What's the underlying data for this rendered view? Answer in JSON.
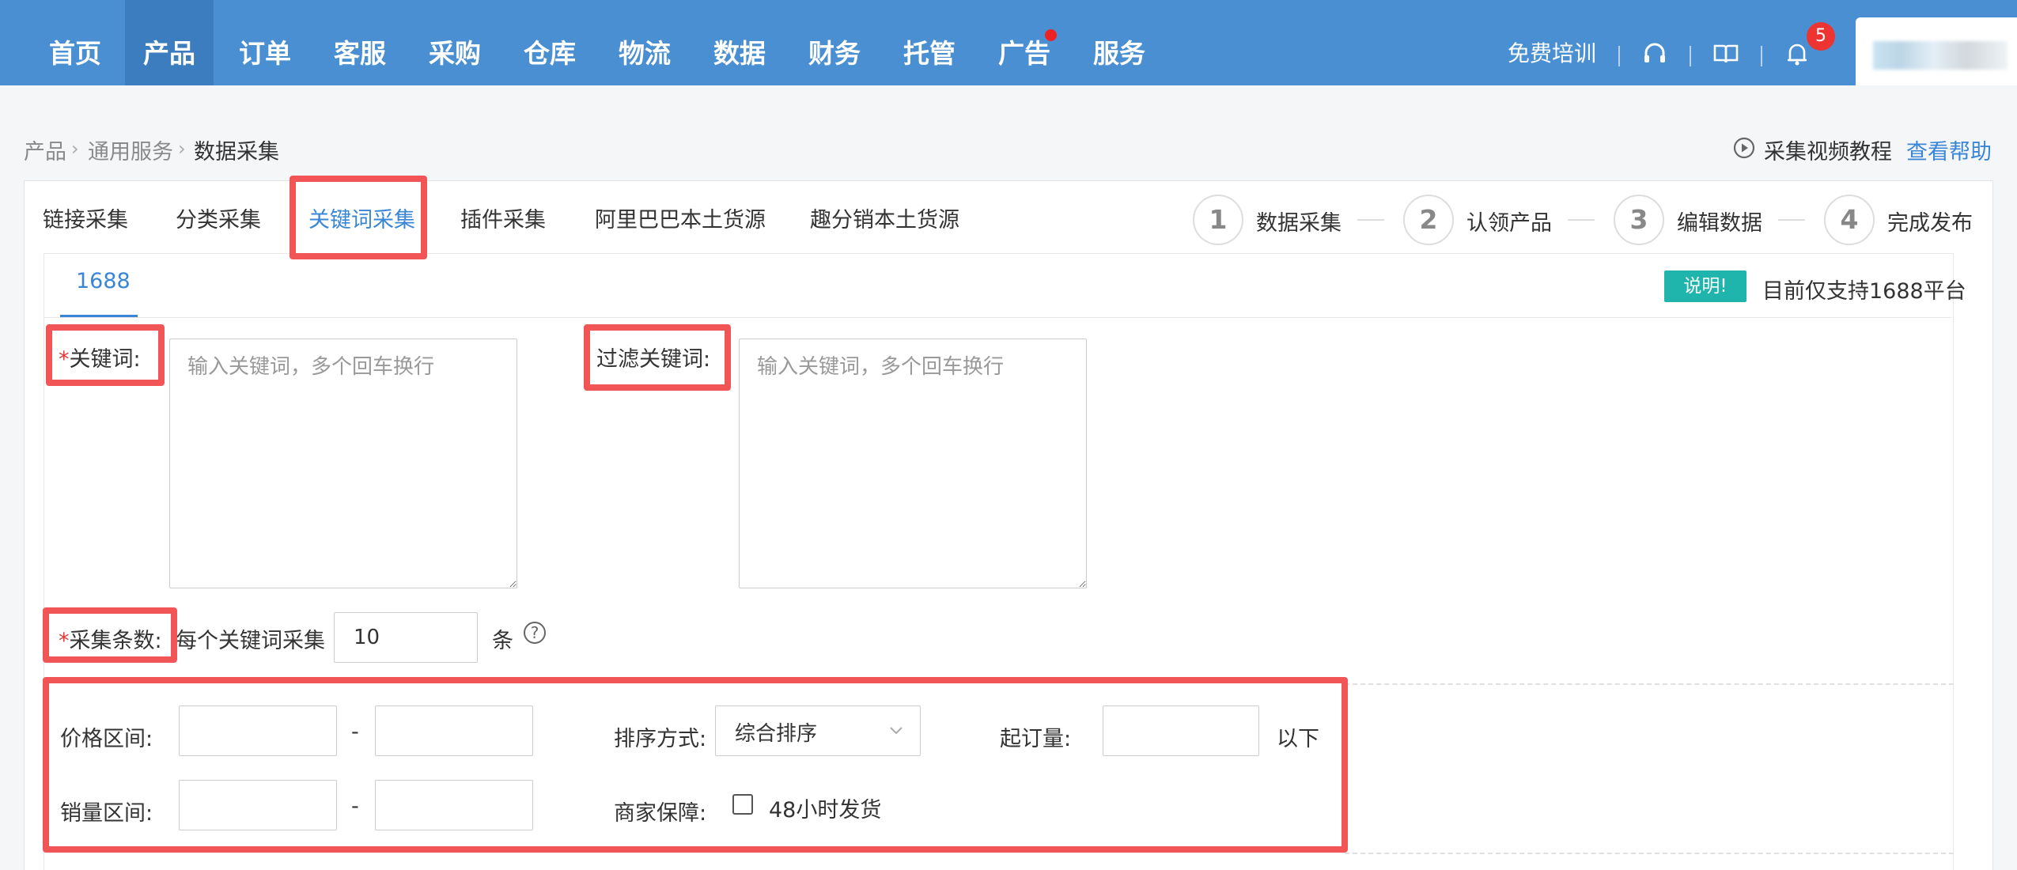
{
  "nav": {
    "items": [
      "首页",
      "产品",
      "订单",
      "客服",
      "采购",
      "仓库",
      "物流",
      "数据",
      "财务",
      "托管",
      "广告",
      "服务"
    ],
    "active": "产品",
    "dot_item": "广告",
    "training_label": "免费培训",
    "icons": [
      "headset-icon",
      "book-icon",
      "bell-icon"
    ],
    "notification_count": "5",
    "colors": {
      "bar": "#4a8fd1",
      "active": "#3c7dc0",
      "badge": "#ee3333"
    }
  },
  "breadcrumb": {
    "items": [
      "产品",
      "通用服务",
      "数据采集"
    ]
  },
  "help": {
    "video_label": "采集视频教程",
    "help_label": "查看帮助"
  },
  "tabs": {
    "items": [
      "链接采集",
      "分类采集",
      "关键词采集",
      "插件采集",
      "阿里巴巴本土货源",
      "趣分销本土货源"
    ],
    "active": "关键词采集"
  },
  "steps": [
    {
      "num": "1",
      "label": "数据采集"
    },
    {
      "num": "2",
      "label": "认领产品"
    },
    {
      "num": "3",
      "label": "编辑数据"
    },
    {
      "num": "4",
      "label": "完成发布"
    }
  ],
  "subtab": {
    "label": "1688"
  },
  "notice": {
    "tag": "说明!",
    "text": "目前仅支持1688平台"
  },
  "form": {
    "keyword_label": "关键词:",
    "keyword_placeholder": "输入关键词，多个回车换行",
    "filter_label": "过滤关键词:",
    "filter_placeholder": "输入关键词，多个回车换行",
    "count_label": "采集条数:",
    "count_prefix": "每个关键词采集",
    "count_value": "10",
    "count_unit": "条",
    "price_label": "价格区间:",
    "range_sep": "-",
    "sales_label": "销量区间:",
    "sort_label": "排序方式:",
    "sort_value": "综合排序",
    "moq_label": "起订量:",
    "moq_unit": "以下",
    "guarantee_label": "商家保障:",
    "guarantee_option": "48小时发货",
    "required_mark": "*"
  },
  "colors": {
    "accent": "#3a86d6",
    "highlight": "#f25555",
    "notice_tag": "#1fb5ac"
  }
}
